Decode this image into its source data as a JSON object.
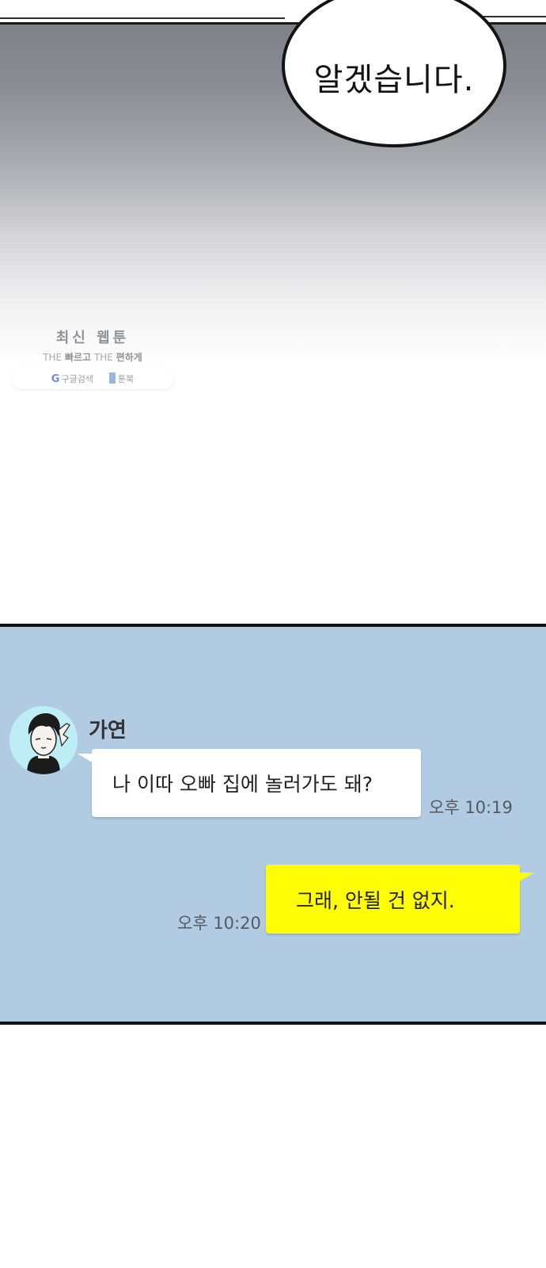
{
  "comic": {
    "speech_text": "알겠습니다."
  },
  "watermark": {
    "title": "최신 웹툰",
    "tagline_prefix": "THE",
    "tagline_bold1": "빠르고",
    "tagline_mid": "THE",
    "tagline_bold2": "편하게",
    "google_label": "구글검색",
    "toonbook_label": "툰북"
  },
  "chat": {
    "background_color": "#b1cbe2",
    "incoming": {
      "sender": "가연",
      "text": "나 이따 오빠 집에 놀러가도 돼?",
      "time": "오후 10:19"
    },
    "outgoing": {
      "text": "그래, 안될 건 없지.",
      "time": "오후 10:20",
      "bubble_color": "#fffd03"
    }
  }
}
